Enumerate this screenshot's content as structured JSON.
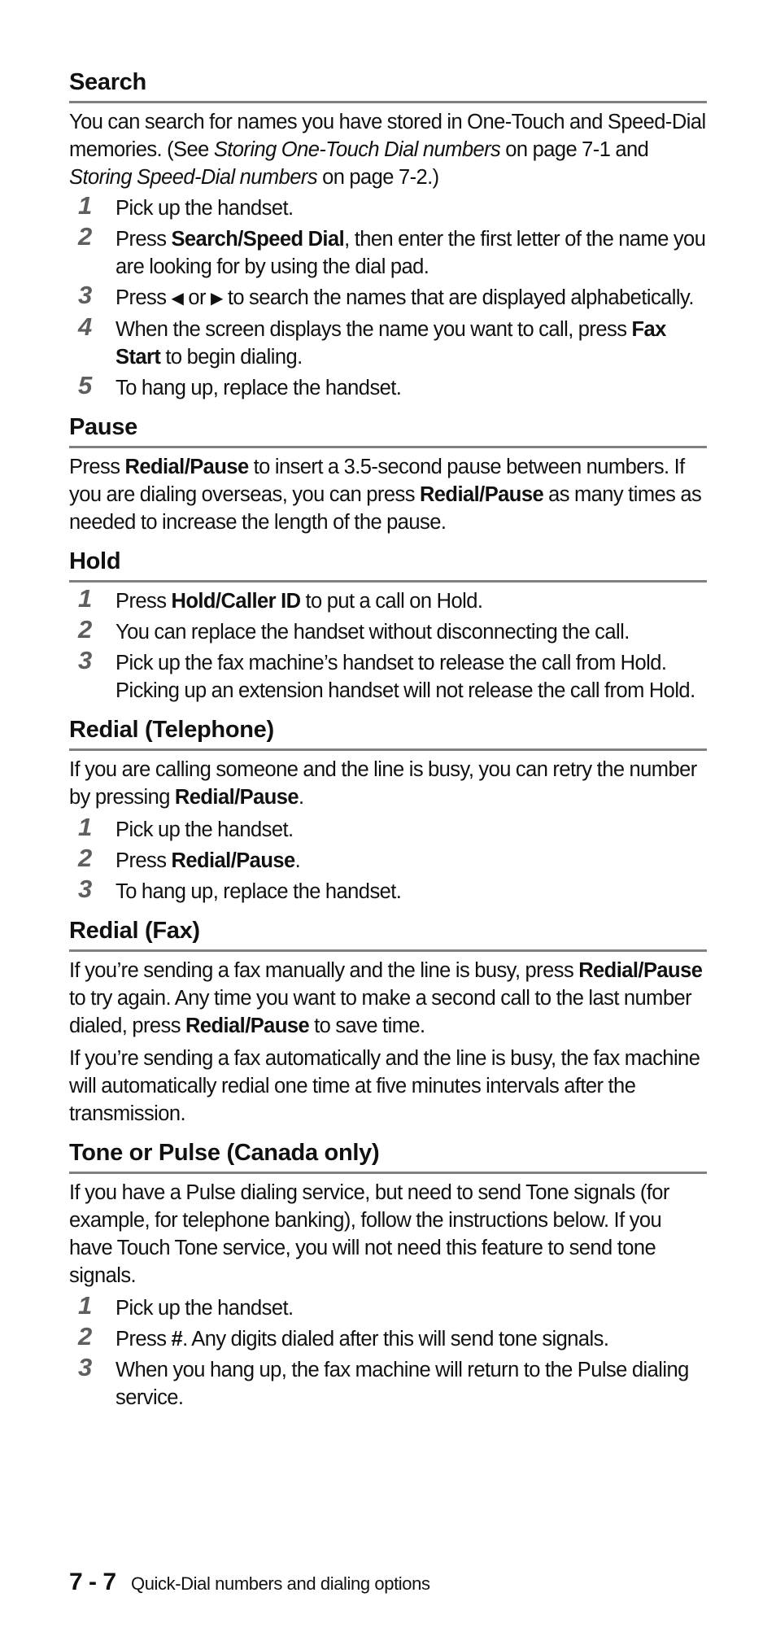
{
  "sections": {
    "search": {
      "title": "Search",
      "intro": {
        "t1": "You can search for names you have stored in One-Touch and Speed-Dial memories. (See ",
        "i1": "Storing One-Touch Dial numbers",
        "t2": " on page 7-1 and ",
        "i2": "Storing Speed-Dial numbers",
        "t3": " on page 7-2.)"
      },
      "steps": [
        {
          "num": "1",
          "text": "Pick up the handset."
        },
        {
          "num": "2",
          "pre": "Press ",
          "bold": "Search/Speed Dial",
          "post": ", then enter the first letter of the name you are looking for by using the dial pad."
        },
        {
          "num": "3",
          "pre": "Press ",
          "left_arrow": "◀",
          "mid": " or ",
          "right_arrow": "▶",
          "post": " to search the names that are displayed alphabetically."
        },
        {
          "num": "4",
          "pre": "When the screen displays the name you want to call, press ",
          "bold": "Fax Start",
          "post": " to begin dialing."
        },
        {
          "num": "5",
          "text": "To hang up, replace the handset."
        }
      ]
    },
    "pause": {
      "title": "Pause",
      "para": {
        "t1": "Press ",
        "b1": "Redial/Pause",
        "t2": " to insert a 3.5-second pause between numbers. If you are dialing overseas, you can press ",
        "b2": "Redial/Pause",
        "t3": " as many times as needed to increase the length of the pause."
      }
    },
    "hold": {
      "title": "Hold",
      "steps": [
        {
          "num": "1",
          "pre": "Press ",
          "bold": "Hold/Caller ID",
          "post": " to put a call on Hold."
        },
        {
          "num": "2",
          "text": "You can replace the handset without disconnecting the call."
        },
        {
          "num": "3",
          "text": "Pick up the fax machine’s handset to release the call from Hold. Picking up an extension handset will not release the call from Hold."
        }
      ]
    },
    "redial_telephone": {
      "title": "Redial (Telephone)",
      "para": {
        "t1": "If you are calling someone and the line is busy, you can retry the number by pressing ",
        "b1": "Redial/Pause",
        "t2": "."
      },
      "steps": [
        {
          "num": "1",
          "text": "Pick up the handset."
        },
        {
          "num": "2",
          "pre": "Press ",
          "bold": "Redial/Pause",
          "post": "."
        },
        {
          "num": "3",
          "text": "To hang up, replace the handset."
        }
      ]
    },
    "redial_fax": {
      "title": "Redial (Fax)",
      "para1": {
        "t1": "If you’re sending a fax manually and the line is busy, press ",
        "b1": "Redial/Pause",
        "t2": " to try again. Any time you want to make a second call to the last number dialed, press ",
        "b2": "Redial/Pause",
        "t3": " to save time."
      },
      "para2": "If you’re sending a fax automatically and the line is busy, the fax machine will automatically redial one time at five minutes intervals after the transmission."
    },
    "tone_pulse": {
      "title": "Tone or Pulse (Canada only)",
      "para": "If you have a Pulse dialing service, but need to send Tone signals (for example, for telephone banking), follow the instructions below. If you have Touch Tone service, you will not need this feature to send tone signals.",
      "steps": [
        {
          "num": "1",
          "text": "Pick up the handset."
        },
        {
          "num": "2",
          "pre": "Press ",
          "bold": "#",
          "post": ". Any digits dialed after this will send tone signals."
        },
        {
          "num": "3",
          "text": "When you hang up, the fax machine will return to the Pulse dialing service."
        }
      ]
    }
  },
  "footer": {
    "page_number": "7 - 7",
    "chapter_title": "Quick-Dial numbers and dialing options"
  }
}
